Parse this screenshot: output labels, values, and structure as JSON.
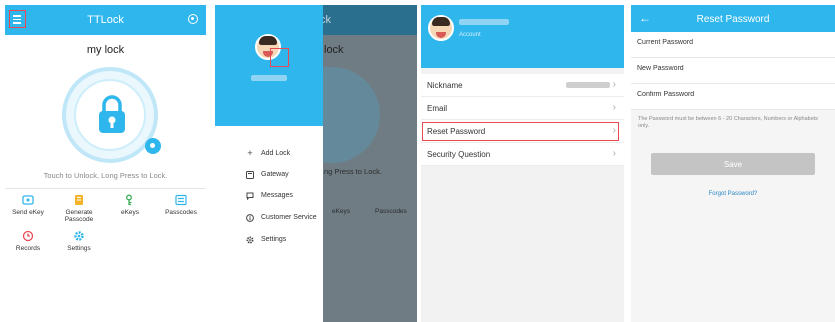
{
  "colors": {
    "accent": "#2fb6ec",
    "highlight": "#e84a55",
    "dimmed": "#6f7c84"
  },
  "panel1": {
    "title": "TTLock",
    "lock_name": "my lock",
    "hint": "Touch to Unlock, Long Press to Lock.",
    "grid": [
      {
        "label": "Send eKey",
        "icon": "send-ekey-icon"
      },
      {
        "label": "Generate Passcode",
        "icon": "generate-passcode-icon"
      },
      {
        "label": "eKeys",
        "icon": "ekeys-icon"
      },
      {
        "label": "Passcodes",
        "icon": "passcodes-icon"
      },
      {
        "label": "Records",
        "icon": "records-icon"
      },
      {
        "label": "Settings",
        "icon": "settings-icon"
      }
    ]
  },
  "panel2": {
    "bg_title": "ck",
    "bg_mylock": "lock",
    "bg_hint": "ng Press to Lock.",
    "bg_ekeys": "eKeys",
    "bg_passcodes": "Passcodes",
    "menu": [
      {
        "label": "Add Lock",
        "icon": "plus-icon"
      },
      {
        "label": "Gateway",
        "icon": "gateway-icon"
      },
      {
        "label": "Messages",
        "icon": "messages-icon"
      },
      {
        "label": "Customer Service",
        "icon": "info-icon"
      },
      {
        "label": "Settings",
        "icon": "gear-icon"
      }
    ]
  },
  "panel3": {
    "account_label": "Account",
    "rows": [
      {
        "label": "Nickname"
      },
      {
        "label": "Email"
      },
      {
        "label": "Reset Password"
      },
      {
        "label": "Security Question"
      }
    ]
  },
  "panel4": {
    "title": "Reset Password",
    "fields": [
      {
        "placeholder": "Current Password"
      },
      {
        "placeholder": "New Password"
      },
      {
        "placeholder": "Confirm Password"
      }
    ],
    "note": "The Password must be between 6 - 20 Characters, Numbers or Alphabets only.",
    "save_label": "Save",
    "forgot_label": "Forgot Password?"
  }
}
